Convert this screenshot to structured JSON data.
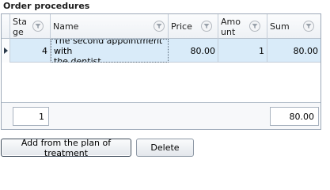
{
  "title": "Order procedures",
  "columns": [
    {
      "label": "Stage"
    },
    {
      "label": "Name"
    },
    {
      "label": "Price"
    },
    {
      "label": "Amount"
    },
    {
      "label": "Sum"
    }
  ],
  "header_display": {
    "stage_l1": "Sta",
    "stage_l2": "ge",
    "amount_l1": "Amo",
    "amount_l2": "unt"
  },
  "rows": [
    {
      "stage": "4",
      "name_l1": "The second appointment with",
      "name_l2": "the dentist",
      "name": "The second appointment with the dentist",
      "price": "80.00",
      "amount": "1",
      "sum": "80.00"
    }
  ],
  "footer": {
    "count": "1",
    "sum_total": "80.00"
  },
  "buttons": {
    "add_from_plan": "Add from the plan of treatment",
    "delete": "Delete"
  }
}
